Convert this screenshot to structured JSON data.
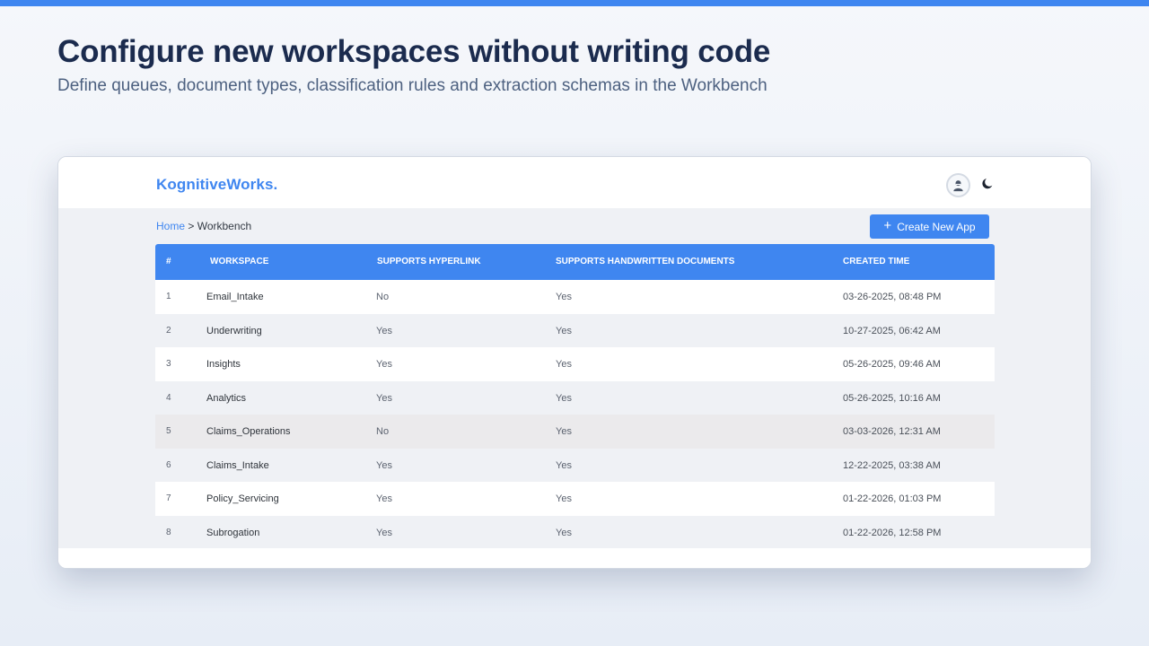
{
  "hero": {
    "title": "Configure new workspaces without writing code",
    "subtitle": "Define queues, document types, classification rules and extraction schemas in the Workbench"
  },
  "app": {
    "logo": "KognitiveWorks.",
    "icons": {
      "avatar": "user-avatar-icon",
      "theme": "moon-icon"
    },
    "colors": {
      "accent": "#3f86f0",
      "title": "#1b2b4e"
    }
  },
  "breadcrumb": {
    "home": "Home",
    "separator": ">",
    "current": "Workbench"
  },
  "actions": {
    "create_label": "Create New App",
    "create_icon": "plus-icon"
  },
  "table": {
    "columns": [
      "#",
      "WORKSPACE",
      "SUPPORTS HYPERLINK",
      "SUPPORTS HANDWRITTEN DOCUMENTS",
      "CREATED TIME"
    ],
    "rows": [
      {
        "id": "1",
        "workspace": "Email_Intake",
        "hyperlink": "No",
        "handwritten": "Yes",
        "created": "03-26-2025, 08:48 PM"
      },
      {
        "id": "2",
        "workspace": "Underwriting",
        "hyperlink": "Yes",
        "handwritten": "Yes",
        "created": "10-27-2025, 06:42 AM"
      },
      {
        "id": "3",
        "workspace": "Insights",
        "hyperlink": "Yes",
        "handwritten": "Yes",
        "created": "05-26-2025, 09:46 AM"
      },
      {
        "id": "4",
        "workspace": "Analytics",
        "hyperlink": "Yes",
        "handwritten": "Yes",
        "created": "05-26-2025, 10:16 AM"
      },
      {
        "id": "5",
        "workspace": "Claims_Operations",
        "hyperlink": "No",
        "handwritten": "Yes",
        "created": "03-03-2026, 12:31 AM"
      },
      {
        "id": "6",
        "workspace": "Claims_Intake",
        "hyperlink": "Yes",
        "handwritten": "Yes",
        "created": "12-22-2025, 03:38 AM"
      },
      {
        "id": "7",
        "workspace": "Policy_Servicing",
        "hyperlink": "Yes",
        "handwritten": "Yes",
        "created": "01-22-2026, 01:03 PM"
      },
      {
        "id": "8",
        "workspace": "Subrogation",
        "hyperlink": "Yes",
        "handwritten": "Yes",
        "created": "01-22-2026, 12:58 PM"
      }
    ]
  }
}
